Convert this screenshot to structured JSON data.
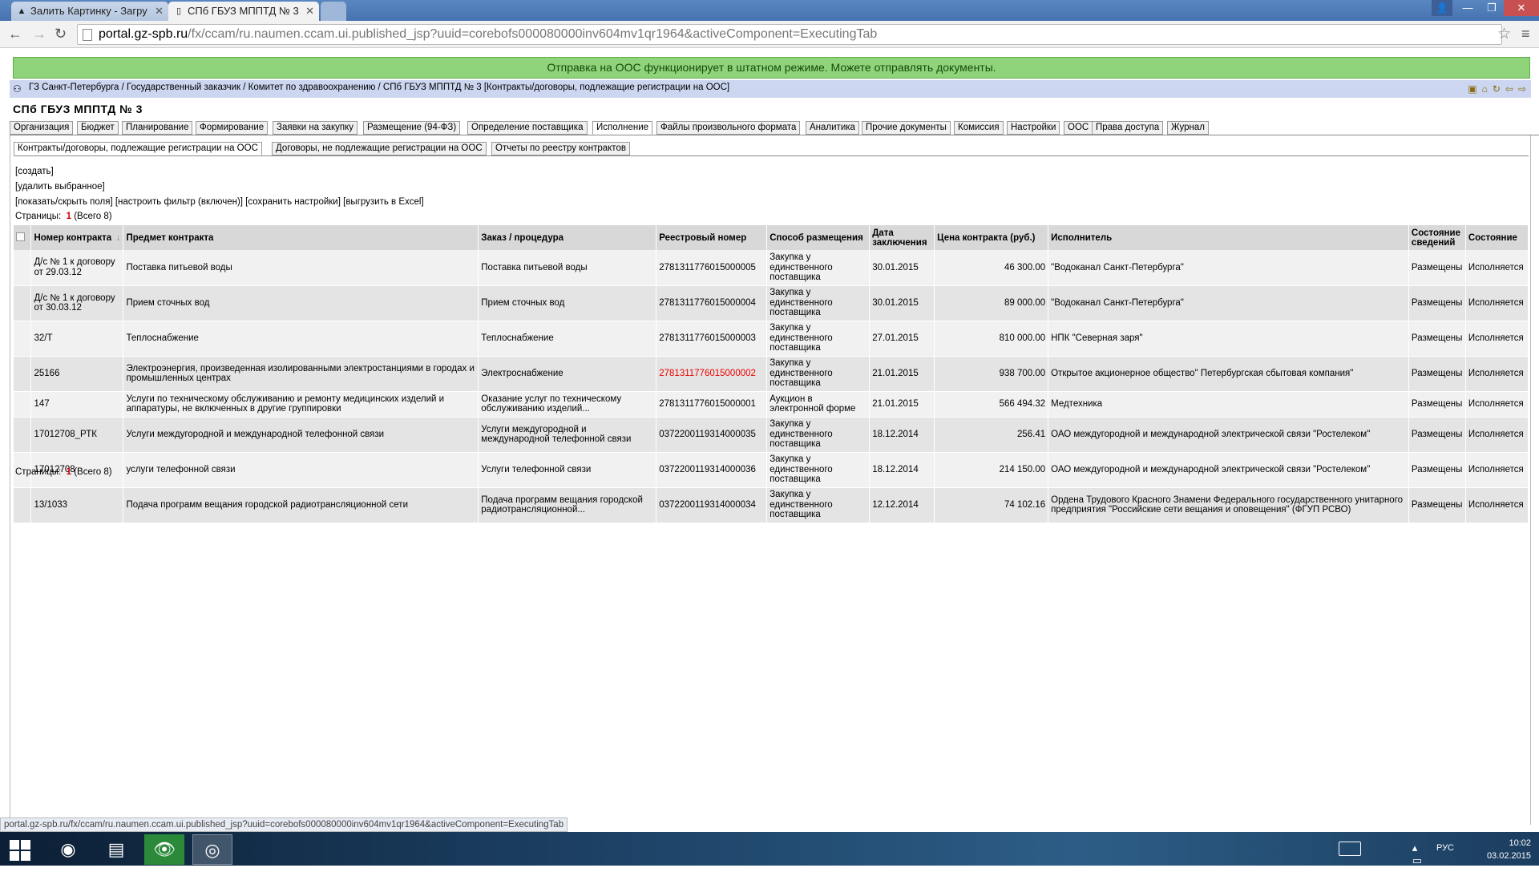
{
  "browser": {
    "tabs": [
      {
        "label": "Залить Картинку - Загру",
        "icon": "image-upload-favicon"
      },
      {
        "label": "СПб ГБУЗ МППТД № 3",
        "icon": "page-favicon"
      }
    ],
    "url_host": "portal.gz-spb.ru",
    "url_path": "/fx/ccam/ru.naumen.ccam.ui.published_jsp?uuid=corebofs000080000inv604mv1qr1964&activeComponent=ExecutingTab"
  },
  "notice": "Отправка на ООС функционирует в штатном режиме. Можете отправлять документы.",
  "breadcrumb": "ГЗ Санкт-Петербурга / Государственный заказчик / Комитет по здравоохранению / СПб ГБУЗ МППТД № 3 [Контракты/договоры, подлежащие регистрации на ООС]",
  "org_title": "СПб ГБУЗ МППТД № 3",
  "main_tabs": [
    "Организация",
    "Бюджет",
    "Планирование",
    "Формирование",
    "Заявки на закупку",
    "Размещение (94-ФЗ)",
    "Определение поставщика",
    "Исполнение",
    "Файлы произвольного формата",
    "Аналитика",
    "Прочие документы",
    "Комиссия",
    "Настройки",
    "ООС",
    "Права доступа",
    "Журнал"
  ],
  "active_main_tab": "Исполнение",
  "sub_tabs": [
    "Контракты/договоры, подлежащие регистрации на ООС",
    "Договоры, не подлежащие регистрации на ООС",
    "Отчеты по реестру контрактов"
  ],
  "actions": {
    "create": "[создать]",
    "delete_selected": "[удалить выбранное]",
    "toggle_fields": "[показать/скрыть поля]",
    "filter": "[настроить фильтр (включен)]",
    "save_settings": "[сохранить настройки]",
    "export_excel": "[выгрузить в Excel]"
  },
  "pager": {
    "label": "Страницы:",
    "page": "1",
    "total": "(Всего 8)"
  },
  "table": {
    "headers": [
      "Номер контракта",
      "Предмет контракта",
      "Заказ / процедура",
      "Реестровый номер",
      "Способ размещения",
      "Дата заключения",
      "Цена контракта (руб.)",
      "Исполнитель",
      "Состояние сведений",
      "Состояние"
    ],
    "rows": [
      [
        "Д/с № 1 к договору от 29.03.12",
        "Поставка питьевой воды",
        "Поставка питьевой воды",
        "2781311776015000005",
        "Закупка у единственного поставщика",
        "30.01.2015",
        "46 300.00",
        "\"Водоканал Санкт-Петербурга\"",
        "Размещены",
        "Исполняется"
      ],
      [
        "Д/с № 1 к договору от 30.03.12",
        "Прием сточных вод",
        "Прием сточных вод",
        "2781311776015000004",
        "Закупка у единственного поставщика",
        "30.01.2015",
        "89 000.00",
        "\"Водоканал Санкт-Петербурга\"",
        "Размещены",
        "Исполняется"
      ],
      [
        "32/Т",
        "Теплоснабжение",
        "Теплоснабжение",
        "2781311776015000003",
        "Закупка у единственного поставщика",
        "27.01.2015",
        "810 000.00",
        "НПК \"Северная заря\"",
        "Размещены",
        "Исполняется"
      ],
      [
        "25166",
        "Электроэнергия, произведенная изолированными электростанциями в городах и промышленных центрах",
        "Электроснабжение",
        "2781311776015000002",
        "Закупка у единственного поставщика",
        "21.01.2015",
        "938 700.00",
        "Открытое акционерное общество\" Петербургская сбытовая компания\"",
        "Размещены",
        "Исполняется"
      ],
      [
        "147",
        "Услуги по техническому обслуживанию и ремонту медицинских изделий и аппаратуры, не включенных в другие группировки",
        "Оказание услуг по техническому обслуживанию изделий...",
        "2781311776015000001",
        "Аукцион в электронной форме",
        "21.01.2015",
        "566 494.32",
        "Медтехника",
        "Размещены",
        "Исполняется"
      ],
      [
        "17012708_РТК",
        "Услуги междугородной и международной телефонной связи",
        "Услуги междугородной и международной телефонной связи",
        "0372200119314000035",
        "Закупка у единственного поставщика",
        "18.12.2014",
        "256.41",
        "ОАО междугородной и международной электрической связи \"Ростелеком\"",
        "Размещены",
        "Исполняется"
      ],
      [
        "17012708",
        "услуги телефонной связи",
        "Услуги телефонной связи",
        "0372200119314000036",
        "Закупка у единственного поставщика",
        "18.12.2014",
        "214 150.00",
        "ОАО междугородной и международной электрической связи \"Ростелеком\"",
        "Размещены",
        "Исполняется"
      ],
      [
        "13/1033",
        "Подача программ вещания городской радиотрансляционной сети",
        "Подача программ вещания городской радиотрансляционной...",
        "0372200119314000034",
        "Закупка у единственного поставщика",
        "12.12.2014",
        "74 102.16",
        "Ордена Трудового Красного Знамени Федерального государственного унитарного предприятия \"Российские сети вещания и оповещения\" (ФГУП РСВО)",
        "Размещены",
        "Исполняется"
      ]
    ],
    "highlighted_cell": "2781311776015000002"
  },
  "status_url": "portal.gz-spb.ru/fx/ccam/ru.naumen.ccam.ui.published_jsp?uuid=corebofs000080000inv604mv1qr1964&activeComponent=ExecutingTab",
  "taskbar": {
    "lang": "РУС",
    "time": "10:02",
    "date": "03.02.2015"
  },
  "colors": {
    "notice_bg": "#8fd47a",
    "breadcrumb_bg": "#ccd6f0",
    "highlight": "#e00000",
    "pager_num": "#cc0000"
  }
}
